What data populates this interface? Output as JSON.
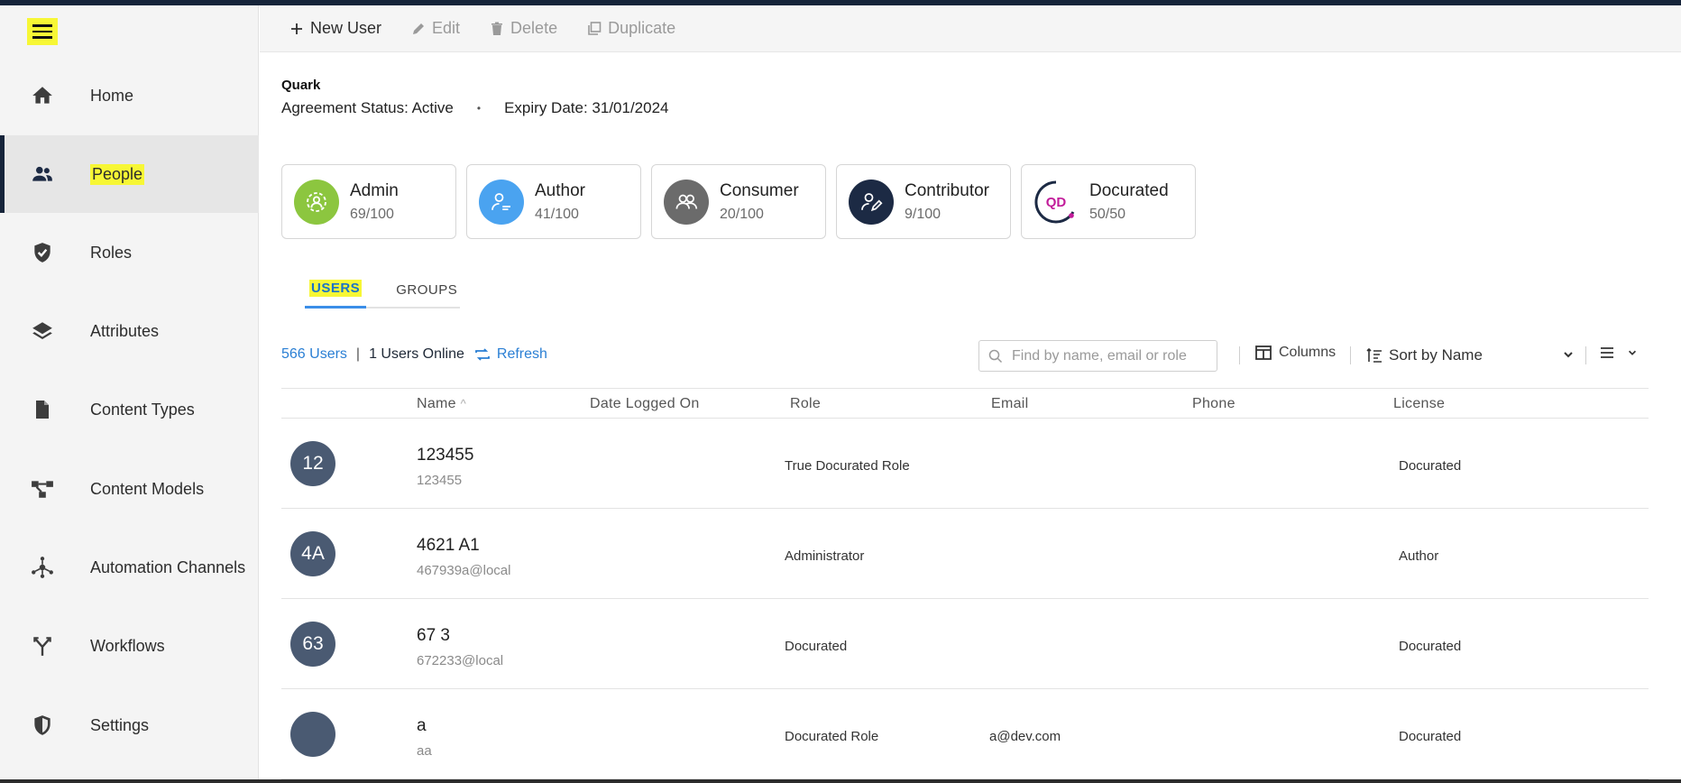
{
  "sidebar": {
    "items": [
      {
        "label": "Home",
        "icon": "home-icon"
      },
      {
        "label": "People",
        "icon": "people-icon"
      },
      {
        "label": "Roles",
        "icon": "shield-check-icon"
      },
      {
        "label": "Attributes",
        "icon": "layers-icon"
      },
      {
        "label": "Content Types",
        "icon": "document-icon"
      },
      {
        "label": "Content Models",
        "icon": "model-icon"
      },
      {
        "label": "Automation Channels",
        "icon": "network-icon"
      },
      {
        "label": "Workflows",
        "icon": "workflow-icon"
      },
      {
        "label": "Settings",
        "icon": "settings-shield-icon"
      }
    ],
    "active": "People"
  },
  "toolbar": {
    "new_user": "New User",
    "edit": "Edit",
    "delete": "Delete",
    "duplicate": "Duplicate"
  },
  "header": {
    "org": "Quark",
    "agreement_status": "Agreement Status: Active",
    "separator": "•",
    "expiry": "Expiry Date: 31/01/2024"
  },
  "licenses": [
    {
      "title": "Admin",
      "count": "69/100",
      "color": "#8cc63f",
      "icon": "gear-people-icon"
    },
    {
      "title": "Author",
      "count": "41/100",
      "color": "#4aa3f0",
      "icon": "author-icon"
    },
    {
      "title": "Consumer",
      "count": "20/100",
      "color": "#6b6b6b",
      "icon": "consumer-icon"
    },
    {
      "title": "Contributor",
      "count": "9/100",
      "color": "#1c2a44",
      "icon": "contributor-icon"
    },
    {
      "title": "Docurated",
      "count": "50/50",
      "color": "#c21c9a",
      "icon": "qd-logo-icon",
      "logo_text": "QD"
    }
  ],
  "tabs": {
    "users": "USERS",
    "groups": "GROUPS"
  },
  "stats": {
    "users": "566 Users",
    "divider": "|",
    "online": "1 Users Online",
    "refresh": "Refresh"
  },
  "search": {
    "placeholder": "Find by name, email or role"
  },
  "columns_label": "Columns",
  "sort": {
    "selected": "Sort by Name"
  },
  "table": {
    "headers": {
      "name": "Name",
      "sort_indicator": "^",
      "date": "Date Logged On",
      "role": "Role",
      "email": "Email",
      "phone": "Phone",
      "license": "License"
    },
    "rows": [
      {
        "initials": "12",
        "name": "123455",
        "login": "123455",
        "role": "True Docurated Role",
        "email": "",
        "phone": "",
        "license": "Docurated"
      },
      {
        "initials": "4A",
        "name": "4621 A1",
        "login": "467939a@local",
        "role": "Administrator",
        "email": "",
        "phone": "",
        "license": "Author"
      },
      {
        "initials": "63",
        "name": "67 3",
        "login": "672233@local",
        "role": "Docurated",
        "email": "",
        "phone": "",
        "license": "Docurated"
      },
      {
        "initials": "",
        "name": "a",
        "login": "aa",
        "role": "Docurated Role",
        "email": "a@dev.com",
        "phone": "",
        "license": "Docurated"
      }
    ]
  }
}
